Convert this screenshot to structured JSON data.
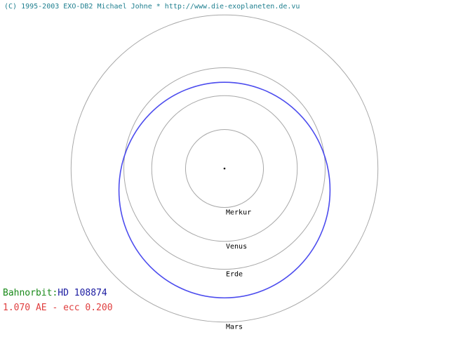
{
  "copyright": "(C) 1995-2003 EXO-DB2 Michael Johne * http://www.die-exoplaneten.de.vu",
  "orbit_label_prefix": "Bahnorbit:",
  "star_name": "HD 108874",
  "orbit_params": "1.070 AE - ecc 0.200",
  "colors": {
    "copyright": "#1f7f8f",
    "prefix": "#1a8a1a",
    "star_name": "#1a1aa0",
    "params": "#e04040",
    "planet_orbits": "#a8a8a8",
    "exo_orbit": "#4c4cee",
    "labels": "#000000"
  },
  "planets": [
    {
      "name": "Merkur",
      "a_au": 0.387
    },
    {
      "name": "Venus",
      "a_au": 0.723
    },
    {
      "name": "Erde",
      "a_au": 1.0
    },
    {
      "name": "Mars",
      "a_au": 1.524
    }
  ],
  "exo_orbit": {
    "a_au": 1.07,
    "ecc": 0.2
  }
}
